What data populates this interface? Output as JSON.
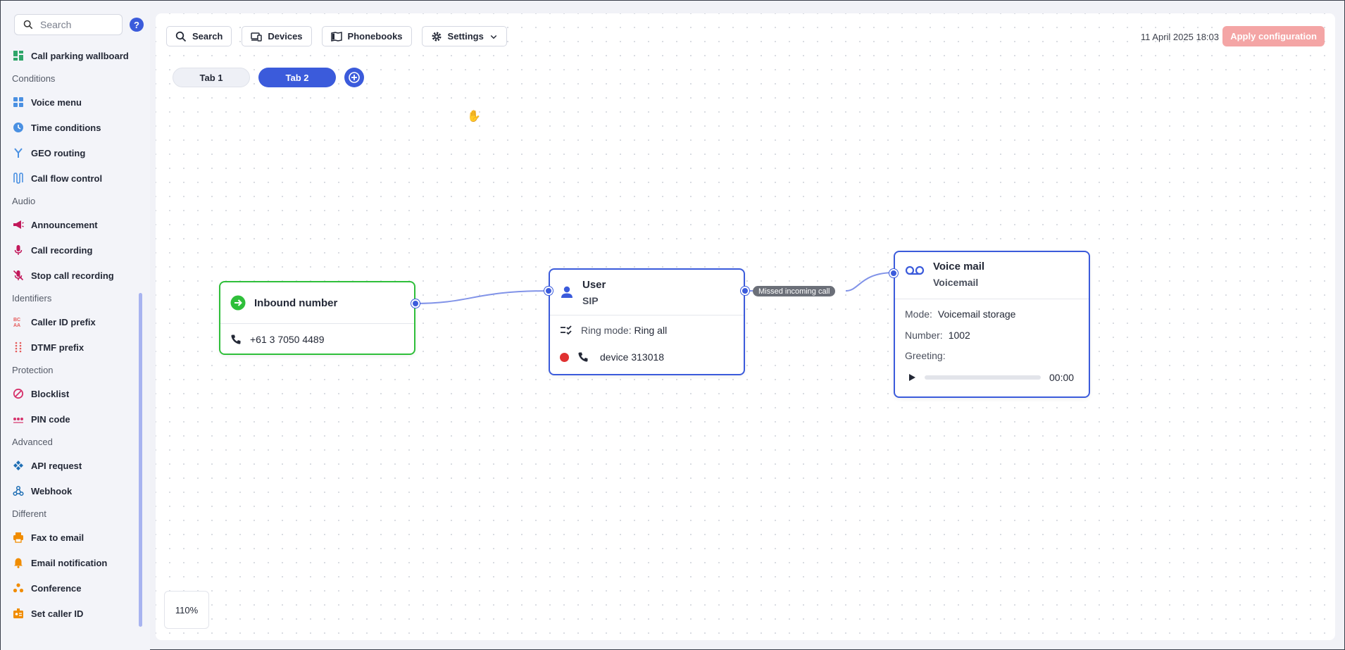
{
  "sidebar": {
    "search_placeholder": "Search",
    "help_label": "?",
    "entries": [
      {
        "kind": "item",
        "label": "Call parking wallboard",
        "icon": "wallboard-icon",
        "color": "#2fa66a"
      },
      {
        "kind": "section",
        "label": "Conditions"
      },
      {
        "kind": "item",
        "label": "Voice menu",
        "icon": "voice-menu-icon",
        "color": "#4a90e2"
      },
      {
        "kind": "item",
        "label": "Time conditions",
        "icon": "clock-icon",
        "color": "#4a90e2"
      },
      {
        "kind": "item",
        "label": "GEO routing",
        "icon": "geo-routing-icon",
        "color": "#4a90e2"
      },
      {
        "kind": "item",
        "label": "Call flow control",
        "icon": "call-flow-icon",
        "color": "#4a90e2"
      },
      {
        "kind": "section",
        "label": "Audio"
      },
      {
        "kind": "item",
        "label": "Announcement",
        "icon": "megaphone-icon",
        "color": "#c2185b"
      },
      {
        "kind": "item",
        "label": "Call recording",
        "icon": "microphone-icon",
        "color": "#c2185b"
      },
      {
        "kind": "item",
        "label": "Stop call recording",
        "icon": "microphone-off-icon",
        "color": "#c2185b"
      },
      {
        "kind": "section",
        "label": "Identifiers"
      },
      {
        "kind": "item",
        "label": "Caller ID prefix",
        "icon": "caller-id-prefix-icon",
        "color": "#e55a5a"
      },
      {
        "kind": "item",
        "label": "DTMF prefix",
        "icon": "dialpad-icon",
        "color": "#e55a5a"
      },
      {
        "kind": "section",
        "label": "Protection"
      },
      {
        "kind": "item",
        "label": "Blocklist",
        "icon": "block-icon",
        "color": "#d6336c"
      },
      {
        "kind": "item",
        "label": "PIN code",
        "icon": "pin-code-icon",
        "color": "#d6336c"
      },
      {
        "kind": "section",
        "label": "Advanced"
      },
      {
        "kind": "item",
        "label": "API request",
        "icon": "api-icon",
        "color": "#1f6fb5"
      },
      {
        "kind": "item",
        "label": "Webhook",
        "icon": "webhook-icon",
        "color": "#1f6fb5"
      },
      {
        "kind": "section",
        "label": "Different"
      },
      {
        "kind": "item",
        "label": "Fax to email",
        "icon": "fax-icon",
        "color": "#f08c00"
      },
      {
        "kind": "item",
        "label": "Email notification",
        "icon": "bell-icon",
        "color": "#f08c00"
      },
      {
        "kind": "item",
        "label": "Conference",
        "icon": "conference-icon",
        "color": "#f08c00"
      },
      {
        "kind": "item",
        "label": "Set caller ID",
        "icon": "set-caller-id-icon",
        "color": "#f08c00"
      }
    ]
  },
  "toolbar": {
    "search_label": "Search",
    "devices_label": "Devices",
    "phonebooks_label": "Phonebooks",
    "settings_label": "Settings"
  },
  "header": {
    "datetime": "11 April 2025 18:03",
    "apply_label": "Apply configuration",
    "apply_color": "#f4a5a5"
  },
  "tabs": [
    {
      "label": "Tab 1",
      "active": false
    },
    {
      "label": "Tab 2",
      "active": true
    }
  ],
  "canvas": {
    "zoom": "110%",
    "edge_label": "Missed incoming call",
    "nodes": {
      "inbound": {
        "title": "Inbound number",
        "number": "+61 3 7050 4489",
        "color": "#2fbf3a"
      },
      "user": {
        "title": "User",
        "subtitle": "SIP",
        "ring_mode_label": "Ring mode:",
        "ring_mode_value": "Ring all",
        "device": "device 313018",
        "status_color": "#e03131"
      },
      "voicemail": {
        "title": "Voice mail",
        "subtitle": "Voicemail",
        "mode_label": "Mode:",
        "mode_value": "Voicemail storage",
        "number_label": "Number:",
        "number_value": "1002",
        "greeting_label": "Greeting:",
        "time": "00:00"
      }
    }
  },
  "accent": "#3b5bdb"
}
